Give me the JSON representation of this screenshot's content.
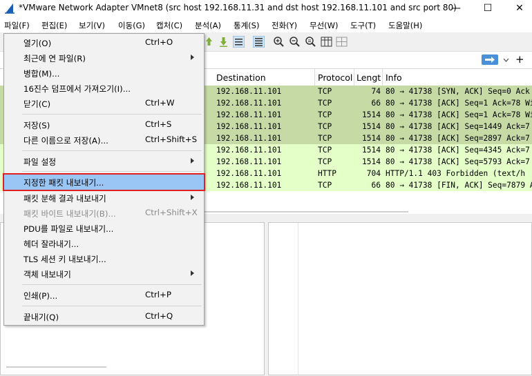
{
  "window": {
    "title": "*VMware Network Adapter VMnet8 (src host 192.168.11.31 and dst host 192.168.11.101 and src port 80)",
    "minimize": "—",
    "maximize": "☐",
    "close": "✕"
  },
  "menubar": [
    "파일(F)",
    "편집(E)",
    "보기(V)",
    "이동(G)",
    "캡처(C)",
    "분석(A)",
    "통계(S)",
    "전화(Y)",
    "무선(W)",
    "도구(T)",
    "도움말(H)"
  ],
  "filter": {
    "apply_icon": "arrow-right-icon",
    "add": "+"
  },
  "packet_list": {
    "columns": [
      "Destination",
      "Protocol",
      "Lengt",
      "Info"
    ],
    "rows": [
      {
        "dst": "192.168.11.101",
        "proto": "TCP",
        "len": "74",
        "info": "80 → 41738 [SYN, ACK] Seq=0 Ack",
        "color": "#c6daa6"
      },
      {
        "dst": "192.168.11.101",
        "proto": "TCP",
        "len": "66",
        "info": "80 → 41738 [ACK] Seq=1 Ack=78 Wi",
        "color": "#c6daa6"
      },
      {
        "dst": "192.168.11.101",
        "proto": "TCP",
        "len": "1514",
        "info": "80 → 41738 [ACK] Seq=1 Ack=78 Wi",
        "color": "#c6daa6"
      },
      {
        "dst": "192.168.11.101",
        "proto": "TCP",
        "len": "1514",
        "info": "80 → 41738 [ACK] Seq=1449 Ack=7",
        "color": "#c6daa6"
      },
      {
        "dst": "192.168.11.101",
        "proto": "TCP",
        "len": "1514",
        "info": "80 → 41738 [ACK] Seq=2897 Ack=7",
        "color": "#c6daa6"
      },
      {
        "dst": "192.168.11.101",
        "proto": "TCP",
        "len": "1514",
        "info": "80 → 41738 [ACK] Seq=4345 Ack=7",
        "color": "#e4ffc7"
      },
      {
        "dst": "192.168.11.101",
        "proto": "TCP",
        "len": "1514",
        "info": "80 → 41738 [ACK] Seq=5793 Ack=7",
        "color": "#e4ffc7"
      },
      {
        "dst": "192.168.11.101",
        "proto": "HTTP",
        "len": "704",
        "info": "HTTP/1.1 403 Forbidden  (text/h",
        "color": "#e4ffc7"
      },
      {
        "dst": "192.168.11.101",
        "proto": "TCP",
        "len": "66",
        "info": "80 → 41738 [FIN, ACK] Seq=7879 A",
        "color": "#e4ffc7"
      }
    ]
  },
  "file_menu": {
    "open": {
      "label": "열기(O)",
      "shortcut": "Ctrl+O"
    },
    "recent": {
      "label": "최근에 연 파일(R)"
    },
    "merge": {
      "label": "병합(M)..."
    },
    "import_hex": {
      "label": "16진수 덤프에서 가져오기(I)..."
    },
    "close": {
      "label": "닫기(C)",
      "shortcut": "Ctrl+W"
    },
    "save": {
      "label": "저장(S)",
      "shortcut": "Ctrl+S"
    },
    "save_as": {
      "label": "다른 이름으로 저장(A)...",
      "shortcut": "Ctrl+Shift+S"
    },
    "file_set": {
      "label": "파일 설정"
    },
    "export_specified": {
      "label": "지정한 패킷 내보내기..."
    },
    "export_dissections": {
      "label": "패킷 분해 결과 내보내기"
    },
    "export_bytes": {
      "label": "패킷 바이트 내보내기(B)...",
      "shortcut": "Ctrl+Shift+X"
    },
    "export_pdu": {
      "label": "PDU를 파일로 내보내기..."
    },
    "strip_headers": {
      "label": "헤더 잘라내기..."
    },
    "export_tls": {
      "label": "TLS 세션 키 내보내기..."
    },
    "export_objects": {
      "label": "객체 내보내기"
    },
    "print": {
      "label": "인쇄(P)...",
      "shortcut": "Ctrl+P"
    },
    "quit": {
      "label": "끝내기(Q)",
      "shortcut": "Ctrl+Q"
    }
  }
}
